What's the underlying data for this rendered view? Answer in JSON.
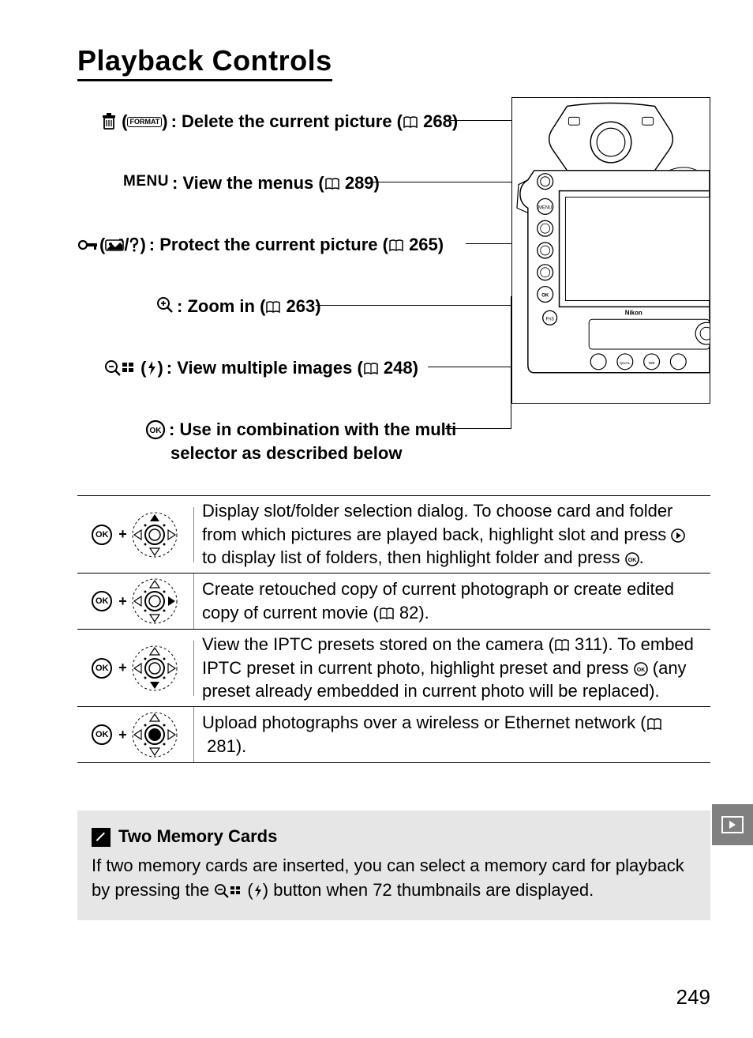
{
  "title": "Playback Controls",
  "controls": [
    {
      "label_before": "",
      "label_after": ": Delete the current picture (",
      "page_ref": "268",
      "close": ")"
    },
    {
      "label_before": "",
      "label_after": ": View the menus (",
      "page_ref": "289",
      "close": ")"
    },
    {
      "label_before": "",
      "label_after": ": Protect the current picture (",
      "page_ref": "265",
      "close": ")"
    },
    {
      "label_before": "",
      "label_after": ": Zoom in (",
      "page_ref": "263",
      "close": ")"
    },
    {
      "label_before": "",
      "label_after": ": View multiple images (",
      "page_ref": "248",
      "close": ")"
    },
    {
      "label_before": "",
      "label_after": ": Use in combination with the multi",
      "page_ref": "",
      "close": ""
    }
  ],
  "menu_text": "MENU",
  "multiselector_line2": "selector as described below",
  "table": [
    {
      "desc_a": "Display slot/folder selection dialog.  To choose card and folder from which pictures are played back, highlight slot and press ",
      "desc_b": " to display list of folders, then highlight folder and press ",
      "desc_c": "."
    },
    {
      "desc_a": "Create retouched copy of current photograph or create edited copy of current movie (",
      "page_ref": "82",
      "desc_c": ")."
    },
    {
      "desc_a": "View the IPTC presets stored on the camera (",
      "page_ref": "311",
      "desc_b": ").  To embed IPTC preset in current photo, highlight preset and press ",
      "desc_c": " (any preset already embedded in current photo will be replaced)."
    },
    {
      "desc_a": "Upload photographs over a wireless or Ethernet network (",
      "page_ref": "281",
      "desc_c": ")."
    }
  ],
  "note": {
    "title": "Two Memory Cards",
    "body_a": "If two memory cards are inserted, you can select a memory card for playback by pressing the ",
    "body_b": " button when 72 thumbnails are displayed."
  },
  "page_number": "249",
  "ok_label": "OK"
}
